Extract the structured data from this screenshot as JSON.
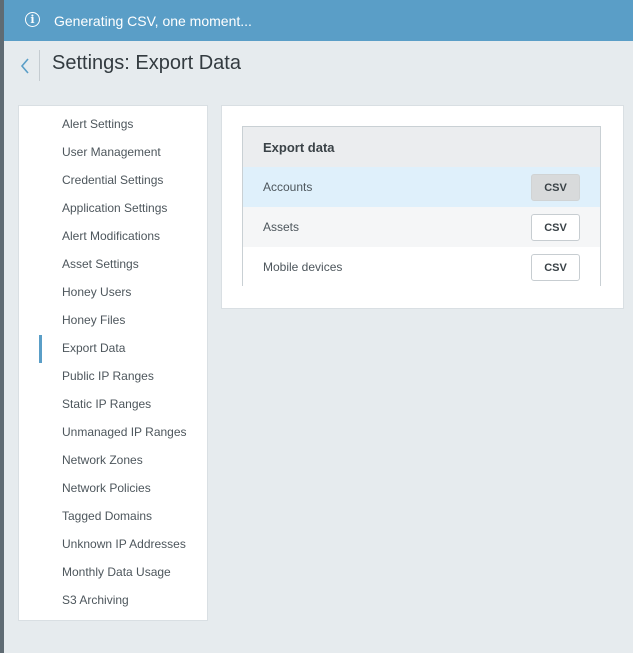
{
  "banner": {
    "text": "Generating CSV, one moment...",
    "icon": "info-icon"
  },
  "header": {
    "title": "Settings: Export Data",
    "back_icon": "chevron-left-icon"
  },
  "sidebar": {
    "items": [
      {
        "label": "Alert Settings"
      },
      {
        "label": "User Management"
      },
      {
        "label": "Credential Settings"
      },
      {
        "label": "Application Settings"
      },
      {
        "label": "Alert Modifications"
      },
      {
        "label": "Asset Settings"
      },
      {
        "label": "Honey Users"
      },
      {
        "label": "Honey Files"
      },
      {
        "label": "Export Data",
        "active": true
      },
      {
        "label": "Public IP Ranges"
      },
      {
        "label": "Static IP Ranges"
      },
      {
        "label": "Unmanaged IP Ranges"
      },
      {
        "label": "Network Zones"
      },
      {
        "label": "Network Policies"
      },
      {
        "label": "Tagged Domains"
      },
      {
        "label": "Unknown IP Addresses"
      },
      {
        "label": "Monthly Data Usage"
      },
      {
        "label": "S3 Archiving"
      }
    ]
  },
  "export": {
    "header": "Export data",
    "rows": [
      {
        "label": "Accounts",
        "button": "CSV"
      },
      {
        "label": "Assets",
        "button": "CSV"
      },
      {
        "label": "Mobile devices",
        "button": "CSV"
      }
    ]
  },
  "colors": {
    "banner": "#5a9ec7",
    "accent": "#5a9ec7",
    "background": "#e6ebee",
    "row_highlight": "#dff0fb",
    "row_alt": "#f5f6f7"
  }
}
